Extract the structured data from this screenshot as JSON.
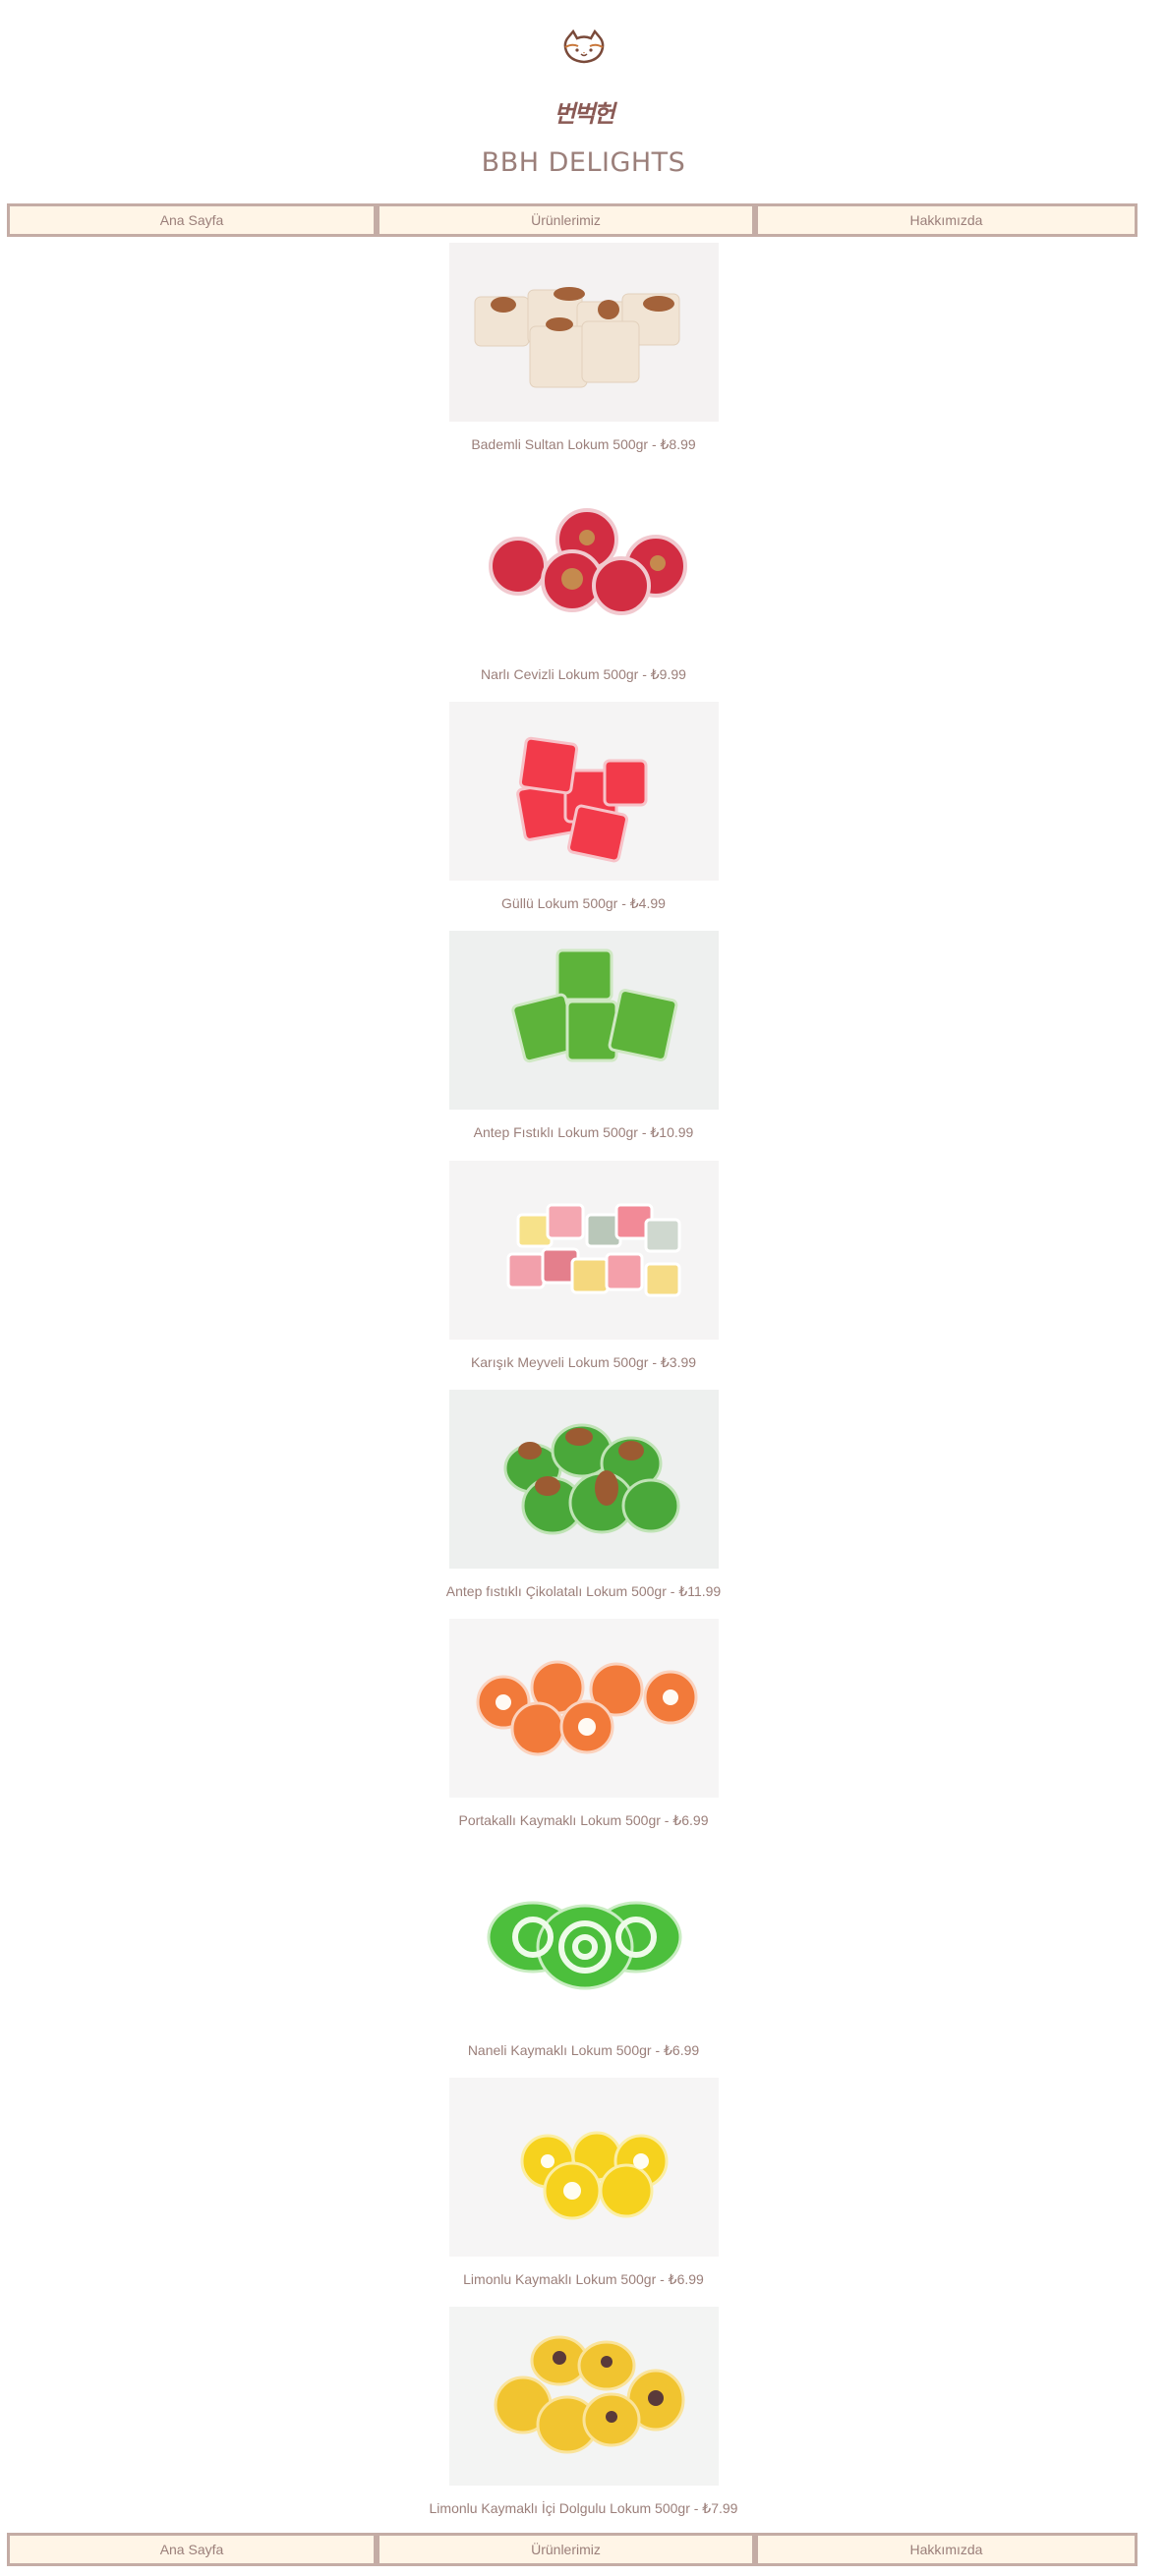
{
  "brand": {
    "logo_icon": "cat-face-icon",
    "hangul_text": "번벅헌",
    "title": "BBH DELIGHTS"
  },
  "nav": {
    "items": [
      {
        "label": "Ana Sayfa"
      },
      {
        "label": "Ürünlerimiz"
      },
      {
        "label": "Hakkımızda"
      }
    ]
  },
  "products": [
    {
      "caption": "Bademli Sultan Lokum 500gr - ₺8.99",
      "photo": "almond-sultan-lokum-photo",
      "color": "#f3e6d6"
    },
    {
      "caption": "Narlı Cevizli Lokum 500gr - ₺9.99",
      "photo": "pomegranate-walnut-lokum-photo",
      "color": "#c81f35"
    },
    {
      "caption": "Güllü Lokum 500gr - ₺4.99",
      "photo": "rose-lokum-photo",
      "color": "#f0303f"
    },
    {
      "caption": "Antep Fıstıklı Lokum 500gr - ₺10.99",
      "photo": "pistachio-lokum-photo",
      "color": "#5db33a"
    },
    {
      "caption": "Karışık Meyveli Lokum 500gr - ₺3.99",
      "photo": "mixed-fruit-lokum-photo",
      "color": "#f3a0a8"
    },
    {
      "caption": "Antep fıstıklı Çikolatalı Lokum 500gr - ₺11.99",
      "photo": "pistachio-chocolate-lokum-photo",
      "color": "#4aa83a"
    },
    {
      "caption": "Portakallı Kaymaklı Lokum 500gr - ₺6.99",
      "photo": "orange-cream-lokum-photo",
      "color": "#f27a3a"
    },
    {
      "caption": "Naneli Kaymaklı Lokum 500gr - ₺6.99",
      "photo": "mint-cream-lokum-photo",
      "color": "#4cbf3c"
    },
    {
      "caption": "Limonlu Kaymaklı Lokum 500gr - ₺6.99",
      "photo": "lemon-cream-lokum-photo",
      "color": "#f6d21e"
    },
    {
      "caption": "Limonlu Kaymaklı İçi Dolgulu Lokum 500gr - ₺7.99",
      "photo": "lemon-filled-lokum-photo",
      "color": "#f1c430"
    }
  ]
}
